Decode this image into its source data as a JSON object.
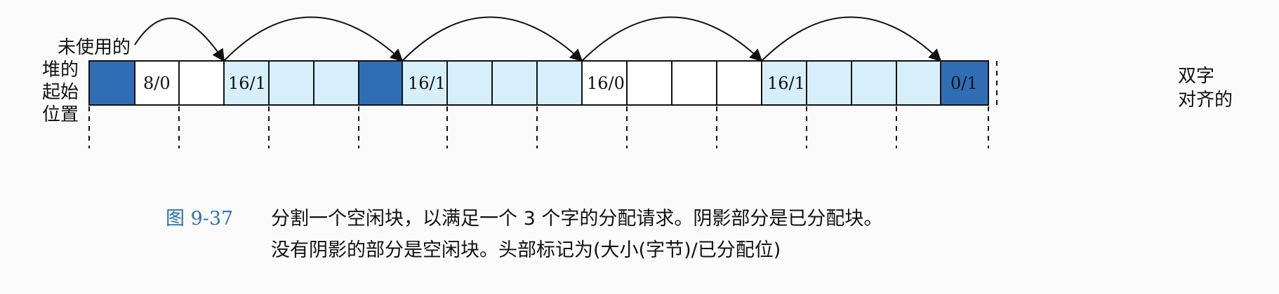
{
  "labels": {
    "heap_start": [
      "未使用的",
      "堆的",
      "起始",
      "位置"
    ],
    "double_word_aligned": [
      "双字",
      "对齐的"
    ]
  },
  "blocks": [
    {
      "type": "padding",
      "shade": "dark",
      "header": ""
    },
    {
      "type": "block",
      "header": "8/0",
      "words": 2,
      "allocated": false
    },
    {
      "type": "block",
      "header": "16/1",
      "words": 4,
      "allocated": true
    },
    {
      "type": "padding-word",
      "shade": "dark",
      "header": ""
    },
    {
      "type": "block",
      "header": "16/1",
      "words": 4,
      "allocated": true
    },
    {
      "type": "block",
      "header": "16/0",
      "words": 4,
      "allocated": false
    },
    {
      "type": "block",
      "header": "16/1",
      "words": 4,
      "allocated": true
    },
    {
      "type": "epilogue",
      "shade": "dark",
      "header": "0/1"
    }
  ],
  "caption": {
    "figure_number": "图 9-37",
    "line1": "分割一个空闲块，以满足一个 3 个字的分配请求。阴影部分是已分配块。",
    "line2": "没有阴影的部分是空闲块。头部标记为(大小(字节)/已分配位)"
  },
  "colors": {
    "dark_block": "#2f6eb5",
    "allocated": "#d7effa",
    "free": "#ffffff",
    "border": "#111111",
    "figure_number": "#2a72b8"
  }
}
